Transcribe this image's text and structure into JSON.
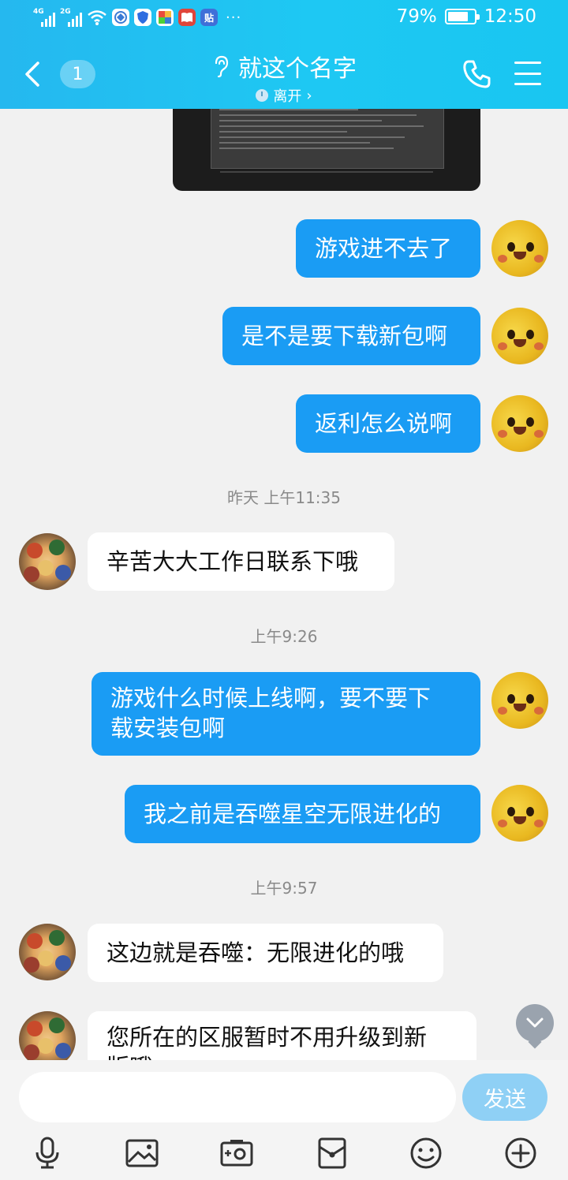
{
  "status_bar": {
    "net1": "4G",
    "net2": "2G",
    "battery_pct": "79%",
    "battery_level": 0.79,
    "time": "12:50",
    "more": "···",
    "app_icons": [
      {
        "name": "wifi-icon"
      },
      {
        "name": "browser-icon",
        "color": "#3a7bd5"
      },
      {
        "name": "shield-app-icon",
        "color": "#2e6de0"
      },
      {
        "name": "colorful-app-icon",
        "color": "#e94b3c"
      },
      {
        "name": "book-app-icon",
        "color": "#e0453a"
      },
      {
        "name": "tieba-app-icon",
        "color": "#3f6fd8",
        "text": "贴"
      }
    ]
  },
  "header": {
    "unread_count": "1",
    "title": "就这个名字",
    "presence": "离开",
    "presence_chevron": "›",
    "colors": {
      "bar_start": "#25b8ef",
      "bar_end": "#19c6f1"
    }
  },
  "messages": [
    {
      "type": "image",
      "from": "other"
    },
    {
      "type": "text",
      "from": "me",
      "text": "游戏进不去了"
    },
    {
      "type": "text",
      "from": "me",
      "text": "是不是要下载新包啊"
    },
    {
      "type": "text",
      "from": "me",
      "text": "返利怎么说啊"
    },
    {
      "type": "time",
      "text": "昨天 上午11:35"
    },
    {
      "type": "text",
      "from": "other",
      "text": "辛苦大大工作日联系下哦"
    },
    {
      "type": "time",
      "text": "上午9:26"
    },
    {
      "type": "text",
      "from": "me",
      "line1": "游戏什么时候上线啊，要不要下",
      "line2": "载安装包啊"
    },
    {
      "type": "text",
      "from": "me",
      "text": "我之前是吞噬星空无限进化的"
    },
    {
      "type": "time",
      "text": "上午9:57"
    },
    {
      "type": "text",
      "from": "other",
      "text": "这边就是吞噬：无限进化的哦"
    },
    {
      "type": "text",
      "from": "other",
      "line1": "您所在的区服暂时不用升级到新",
      "line2": "版哦"
    }
  ],
  "composer": {
    "input_value": "",
    "send_label": "发送",
    "send_color": "#8fd0f5",
    "tools": [
      "microphone-icon",
      "image-icon",
      "video-icon",
      "red-packet-icon",
      "emoji-icon",
      "plus-icon"
    ]
  }
}
